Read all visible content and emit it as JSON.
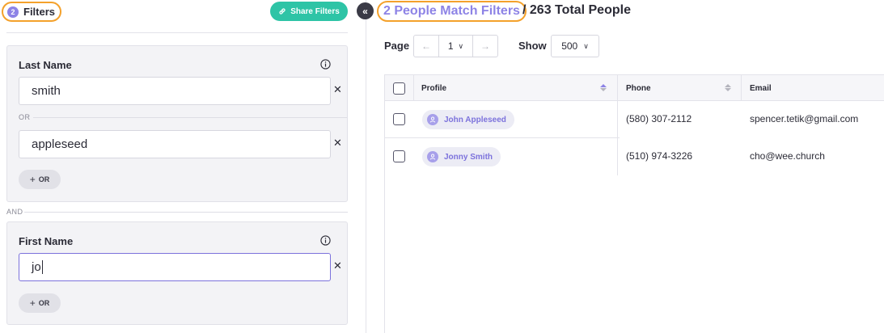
{
  "filters": {
    "count": "2",
    "label": "Filters",
    "share_label": "Share Filters",
    "groups": [
      {
        "title": "Last Name",
        "values": [
          "smith",
          "appleseed"
        ],
        "or_separator": "OR",
        "add_or_label": "OR"
      },
      {
        "title": "First Name",
        "values": [
          "jo"
        ],
        "add_or_label": "OR"
      }
    ],
    "and_separator": "AND"
  },
  "results": {
    "match_label": "2 People Match Filters",
    "total_label": "/ 263 Total People",
    "page_label": "Page",
    "page_value": "1",
    "show_label": "Show",
    "show_value": "500",
    "columns": [
      "Profile",
      "Phone",
      "Email"
    ],
    "rows": [
      {
        "name": "John Appleseed",
        "phone": "(580) 307-2112",
        "email": "spencer.tetik@gmail.com"
      },
      {
        "name": "Jonny Smith",
        "phone": "(510) 974-3226",
        "email": "cho@wee.church"
      }
    ]
  },
  "colors": {
    "accent": "#8d83e6",
    "highlight_outline": "#f4a12b",
    "share_button": "#2ec4a6"
  },
  "icons": {
    "filters_count_badge": "circle-badge",
    "share": "link-icon",
    "info": "info-icon",
    "remove": "close-icon",
    "collapse": "double-chevron-left-icon",
    "avatar": "user-icon"
  }
}
